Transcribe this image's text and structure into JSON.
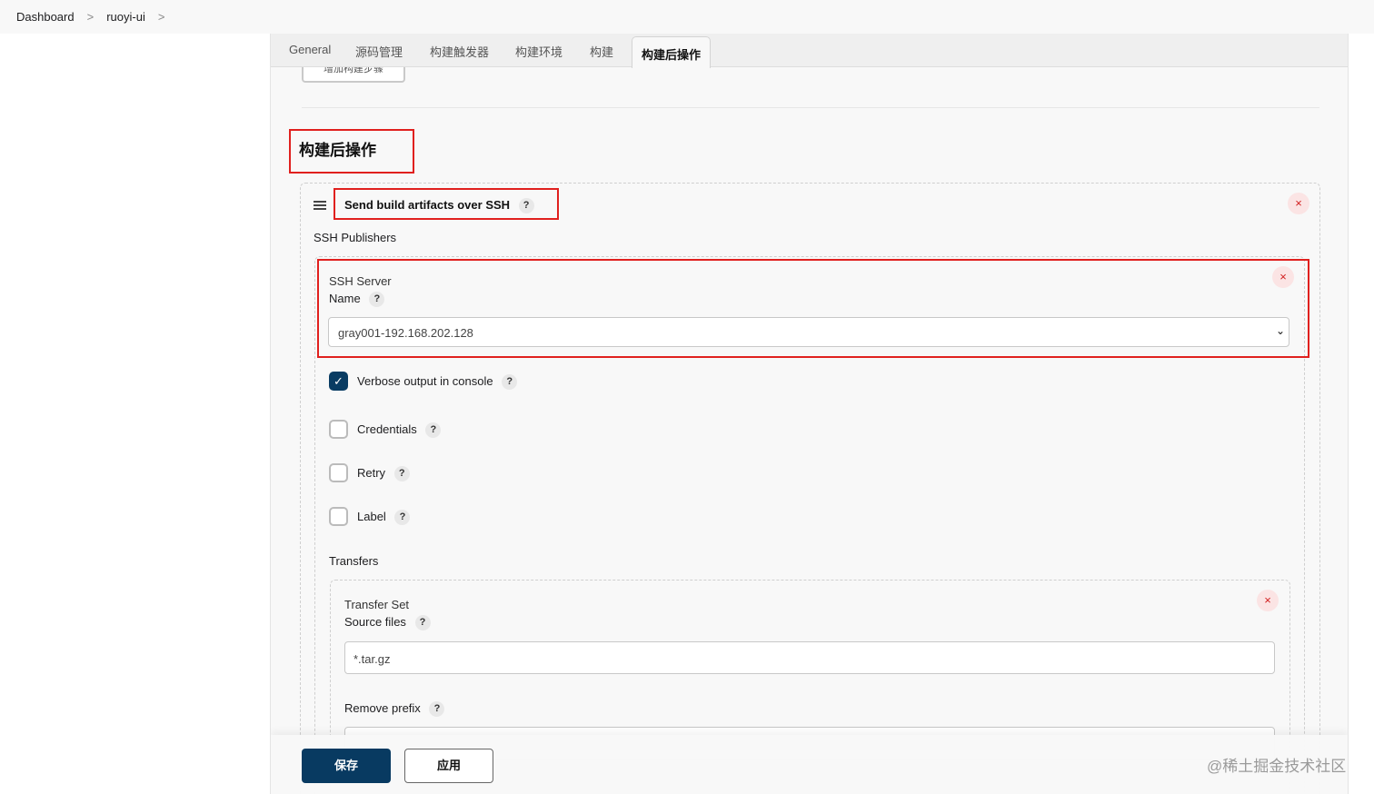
{
  "breadcrumb": {
    "items": [
      "Dashboard",
      "ruoyi-ui"
    ],
    "separator": ">"
  },
  "tabs": [
    {
      "label": "General"
    },
    {
      "label": "源码管理"
    },
    {
      "label": "构建触发器"
    },
    {
      "label": "构建环境"
    },
    {
      "label": "构建"
    },
    {
      "label": "构建后操作",
      "active": true
    }
  ],
  "add_step_button": "增加构建步骤",
  "section_title": "构建后操作",
  "publisher": {
    "title": "Send build artifacts over SSH",
    "help": "?",
    "ssh_publishers_label": "SSH Publishers",
    "close": "×"
  },
  "ssh_server": {
    "heading": "SSH Server",
    "name_label": "Name",
    "selected_value": "gray001-192.168.202.128"
  },
  "options": [
    {
      "label": "Verbose output in console",
      "checked": true
    },
    {
      "label": "Credentials",
      "checked": false
    },
    {
      "label": "Retry",
      "checked": false
    },
    {
      "label": "Label",
      "checked": false
    }
  ],
  "transfers": {
    "label": "Transfers",
    "set_heading": "Transfer Set",
    "source_files_label": "Source files",
    "source_files_value": "*.tar.gz",
    "remove_prefix_label": "Remove prefix"
  },
  "footer": {
    "save": "保存",
    "apply": "应用"
  },
  "watermark": "@稀土掘金技术社区",
  "colors": {
    "primary": "#093c63",
    "highlight": "#e0201e",
    "danger": "#d21f1f"
  }
}
